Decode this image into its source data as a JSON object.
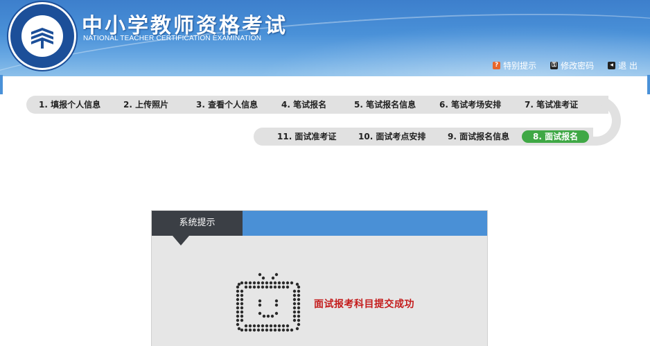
{
  "header": {
    "title": "中小学教师资格考试",
    "subtitle": "NATIONAL TEACHER CERTIFICATION EXAMINATION",
    "links": [
      {
        "label": "特别提示",
        "icon": "question-icon"
      },
      {
        "label": "修改密码",
        "icon": "key-icon"
      },
      {
        "label": "退 出",
        "icon": "logout-icon"
      }
    ]
  },
  "steps": {
    "row1": [
      {
        "label": "1. 填报个人信息"
      },
      {
        "label": "2. 上传照片"
      },
      {
        "label": "3. 查看个人信息"
      },
      {
        "label": "4. 笔试报名"
      },
      {
        "label": "5. 笔试报名信息"
      },
      {
        "label": "6. 笔试考场安排"
      },
      {
        "label": "7. 笔试准考证"
      }
    ],
    "row2": [
      {
        "label": "11. 面试准考证"
      },
      {
        "label": "10. 面试考点安排"
      },
      {
        "label": "9. 面试报名信息"
      },
      {
        "label": "8. 面试报名",
        "active": true
      }
    ]
  },
  "notice": {
    "tab_label": "系统提示",
    "message": "面试报考科目提交成功",
    "icon": "tv-smile-icon"
  },
  "colors": {
    "header_blue": "#4a91d8",
    "active_step": "#3fa845",
    "message_red": "#c41b1b",
    "panel_tab": "#3b3f45"
  }
}
